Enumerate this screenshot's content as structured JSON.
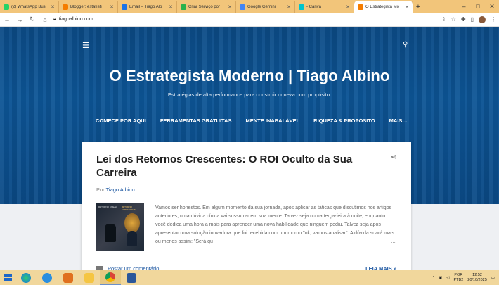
{
  "browser": {
    "tabs": [
      {
        "title": "(2) WhatsApp Bus",
        "color": "#25d366"
      },
      {
        "title": "Blogger: estatísti",
        "color": "#f57d00"
      },
      {
        "title": "Email – Tiago Alb",
        "color": "#1a73e8"
      },
      {
        "title": "Criar Serviço por",
        "color": "#2bb24c"
      },
      {
        "title": "Google Gemini",
        "color": "#4285f4"
      },
      {
        "title": "- Canva",
        "color": "#00c4cc"
      },
      {
        "title": "O Estrategista Mo",
        "color": "#f57d00"
      }
    ],
    "url": "tiagoalbino.com"
  },
  "site": {
    "title": "O Estrategista Moderno | Tiago Albino",
    "subtitle": "Estratégias de alta performance para construir riqueza com propósito.",
    "menu": [
      "COMECE POR AQUI",
      "FERRAMENTAS GRATUITAS",
      "MENTE INABALÁVEL",
      "RIQUEZA & PROPÓSITO",
      "MAIS…"
    ]
  },
  "post": {
    "title": "Lei dos Retornos Crescentes: O ROI Oculto da Sua Carreira",
    "by_prefix": "Por",
    "author": "Tiago Albino",
    "thumb_left": "RETORNO LINEAR",
    "thumb_right": "RETORNO EXPONENCIAL",
    "snippet": "Vamos ser honestos. Em algum momento da sua jornada, após aplicar as táticas que discutimos nos artigos anteriores, uma dúvida cínica vai sussurrar em sua mente. Talvez seja numa terça-feira à noite, enquanto você dedica uma hora a mais para aprender uma nova habilidade que ninguém pediu. Talvez seja após apresentar uma solução inovadora que foi recebida com um morno \"ok, vamos analisar\". A dúvida soará mais ou menos assim: \"Será qu",
    "ellipsis": "…",
    "comment": "Postar um comentário",
    "read_more": "LEIA MAIS »"
  },
  "taskbar": {
    "lang": "POR",
    "layout": "PTB2",
    "time": "12:52",
    "date": "20/10/2025"
  }
}
